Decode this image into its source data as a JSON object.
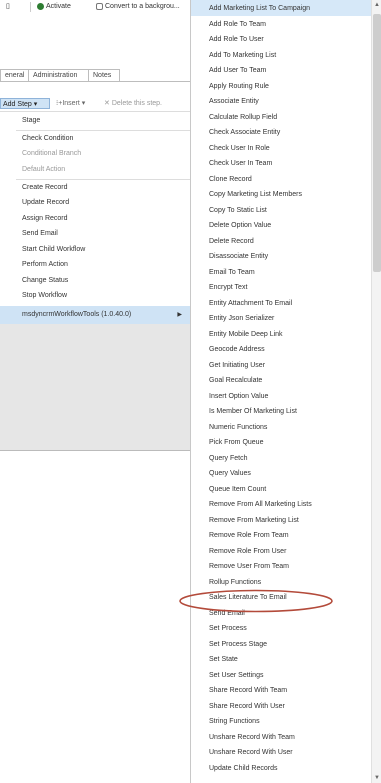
{
  "toolbar": {
    "activate_label": "Activate",
    "convert_label": "Convert to a backgrou..."
  },
  "tabs": [
    {
      "label": "eneral"
    },
    {
      "label": "Administration"
    },
    {
      "label": "Notes"
    }
  ],
  "steps_toolbar": {
    "add_step_label": "Add Step",
    "insert_label": "Insert",
    "delete_label": "Delete this step."
  },
  "add_step_menu": {
    "items": [
      {
        "label": "Stage"
      },
      {
        "label": "Check Condition"
      },
      {
        "label": "Conditional Branch"
      },
      {
        "label": "Default Action"
      },
      {
        "label": "Create Record"
      },
      {
        "label": "Update Record"
      },
      {
        "label": "Assign Record"
      },
      {
        "label": "Send Email"
      },
      {
        "label": "Start Child Workflow"
      },
      {
        "label": "Perform Action"
      },
      {
        "label": "Change Status"
      },
      {
        "label": "Stop Workflow"
      },
      {
        "label": "msdyncrmWorkflowTools (1.0.40.0)"
      }
    ]
  },
  "submenu": {
    "items": [
      {
        "label": "Add Marketing List To Campaign"
      },
      {
        "label": "Add Role To Team"
      },
      {
        "label": "Add Role To User"
      },
      {
        "label": "Add To Marketing List"
      },
      {
        "label": "Add User To Team"
      },
      {
        "label": "Apply Routing Rule"
      },
      {
        "label": "Associate Entity"
      },
      {
        "label": "Calculate Rollup Field"
      },
      {
        "label": "Check Associate Entity"
      },
      {
        "label": "Check User In Role"
      },
      {
        "label": "Check User In Team"
      },
      {
        "label": "Clone Record"
      },
      {
        "label": "Copy Marketing List Members"
      },
      {
        "label": "Copy To Static List"
      },
      {
        "label": "Delete Option Value"
      },
      {
        "label": "Delete Record"
      },
      {
        "label": "Disassociate Entity"
      },
      {
        "label": "Email To Team"
      },
      {
        "label": "Encrypt Text"
      },
      {
        "label": "Entity Attachment To Email"
      },
      {
        "label": "Entity Json Serializer"
      },
      {
        "label": "Entity Mobile Deep Link"
      },
      {
        "label": "Geocode Address"
      },
      {
        "label": "Get Initiating User"
      },
      {
        "label": "Goal Recalculate"
      },
      {
        "label": "Insert Option Value"
      },
      {
        "label": "Is Member Of Marketing List"
      },
      {
        "label": "Numeric Functions"
      },
      {
        "label": "Pick From Queue"
      },
      {
        "label": "Query Fetch"
      },
      {
        "label": "Query Values"
      },
      {
        "label": "Queue Item Count"
      },
      {
        "label": "Remove From All Marketing Lists"
      },
      {
        "label": "Remove From Marketing List"
      },
      {
        "label": "Remove Role From Team"
      },
      {
        "label": "Remove Role From User"
      },
      {
        "label": "Remove User From Team"
      },
      {
        "label": "Rollup Functions"
      },
      {
        "label": "Sales Literature To Email"
      },
      {
        "label": "Send Email"
      },
      {
        "label": "Set Process"
      },
      {
        "label": "Set Process Stage"
      },
      {
        "label": "Set State"
      },
      {
        "label": "Set User Settings"
      },
      {
        "label": "Share Record With Team"
      },
      {
        "label": "Share Record With User"
      },
      {
        "label": "String Functions"
      },
      {
        "label": "Unshare Record With Team"
      },
      {
        "label": "Unshare Record With User"
      },
      {
        "label": "Update Child Records"
      }
    ]
  },
  "colors": {
    "highlight": "#cfe3f5",
    "annotation": "#b34a3a",
    "activate_icon": "#2e7d32"
  }
}
